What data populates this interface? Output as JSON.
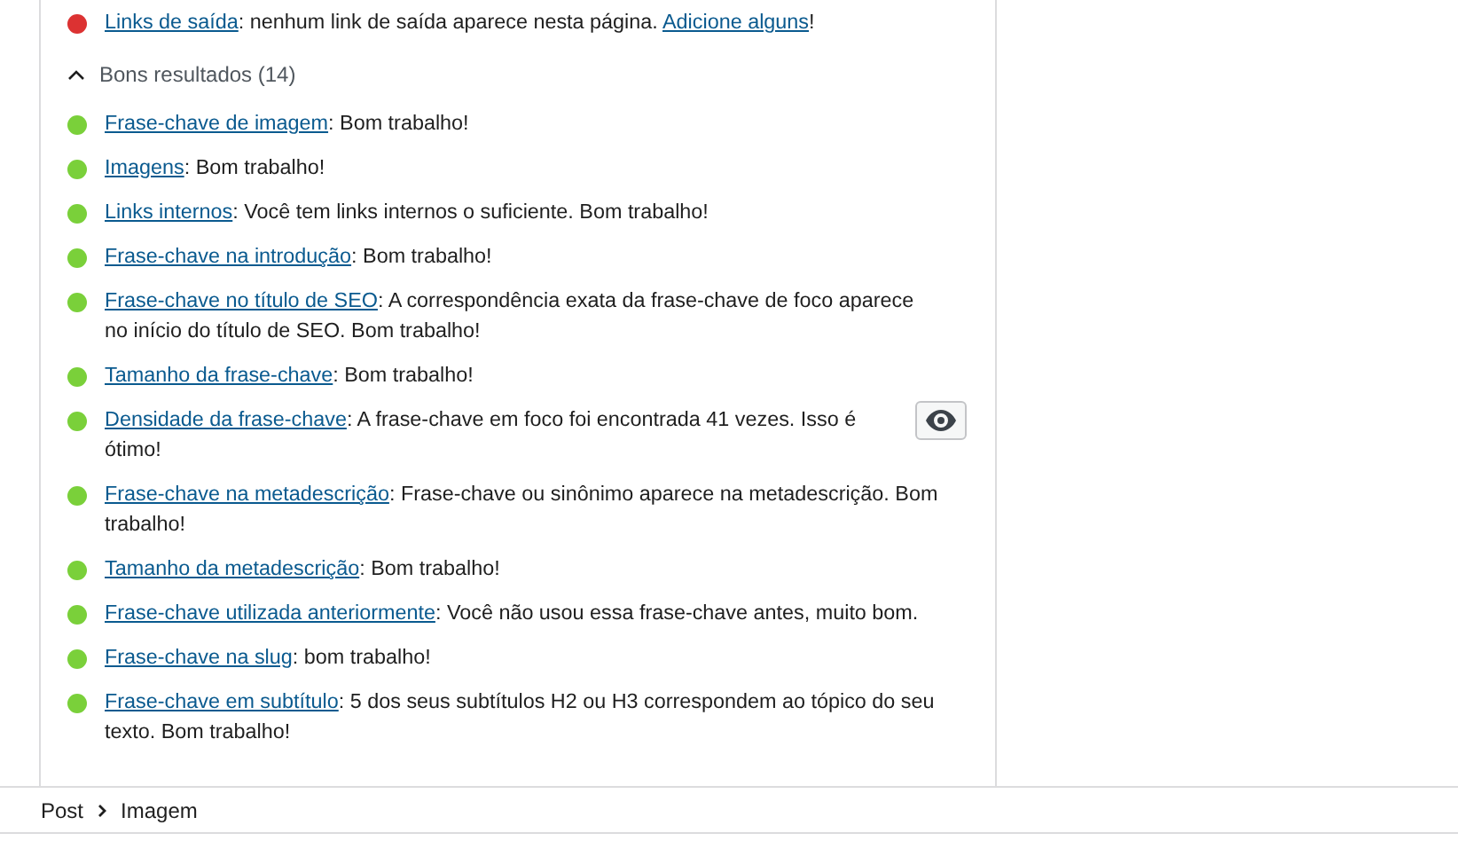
{
  "problems": [
    {
      "link": "Links de saída",
      "text": ": nenhum link de saída aparece nesta página. ",
      "extra_link": "Adicione alguns",
      "after": "!",
      "color": "#dc3232",
      "marker": false
    }
  ],
  "good_section": {
    "title": "Bons resultados (14)",
    "expanded": true
  },
  "good_results": [
    {
      "link": "Frase-chave de imagem",
      "text": ": Bom trabalho!",
      "color": "#7ad03a",
      "marker": false
    },
    {
      "link": "Imagens",
      "text": ": Bom trabalho!",
      "color": "#7ad03a",
      "marker": false
    },
    {
      "link": "Links internos",
      "text": ": Você tem links internos o suficiente. Bom trabalho!",
      "color": "#7ad03a",
      "marker": false
    },
    {
      "link": "Frase-chave na introdução",
      "text": ": Bom trabalho!",
      "color": "#7ad03a",
      "marker": false
    },
    {
      "link": "Frase-chave no título de SEO",
      "text": ": A correspondência exata da frase-chave de foco aparece no início do título de SEO. Bom trabalho!",
      "color": "#7ad03a",
      "marker": false
    },
    {
      "link": "Tamanho da frase-chave",
      "text": ": Bom trabalho!",
      "color": "#7ad03a",
      "marker": false
    },
    {
      "link": "Densidade da frase-chave",
      "text": ": A frase-chave em foco foi encontrada 41 vezes. Isso é ótimo!",
      "color": "#7ad03a",
      "marker": true
    },
    {
      "link": "Frase-chave na metadescrição",
      "text": ": Frase-chave ou sinônimo aparece na metadescrição. Bom trabalho!",
      "color": "#7ad03a",
      "marker": false
    },
    {
      "link": "Tamanho da metadescrição",
      "text": ": Bom trabalho!",
      "color": "#7ad03a",
      "marker": false
    },
    {
      "link": "Frase-chave utilizada anteriormente",
      "text": ": Você não usou essa frase-chave antes, muito bom.",
      "color": "#7ad03a",
      "marker": false
    },
    {
      "link": "Frase-chave na slug",
      "text": ": bom trabalho!",
      "color": "#7ad03a",
      "marker": false
    },
    {
      "link": "Frase-chave em subtítulo",
      "text": ": 5 dos seus subtítulos H2 ou H3 correspondem ao tópico do seu texto. Bom trabalho!",
      "color": "#7ad03a",
      "marker": false
    }
  ],
  "breadcrumbs": [
    {
      "label": "Post"
    },
    {
      "label": "Imagem"
    }
  ]
}
